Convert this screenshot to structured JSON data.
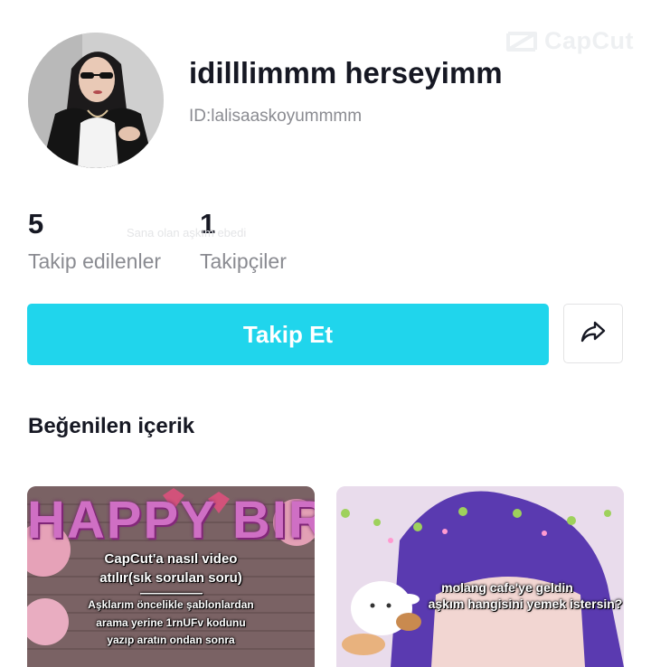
{
  "watermark": {
    "label": "CapCut",
    "icon": "capcut-logo-icon"
  },
  "profile": {
    "display_name": "idilllimmm herseyimm",
    "user_id": "ID:lalisaaskoyummmm",
    "avatar_icon": "profile-avatar"
  },
  "stats": {
    "following_count": "5",
    "following_label": "Takip edilenler",
    "followers_count": "1",
    "followers_label": "Takipçiler"
  },
  "overlay_caption": "Sana olan aşkım ebedi",
  "actions": {
    "follow_label": "Takip Et",
    "share_icon": "share-arrow-icon"
  },
  "liked_section": {
    "title": "Beğenilen içerik",
    "items": [
      {
        "background_text": "HAPPY BIRTHDAY",
        "lines": [
          "CapCut'a nasıl video",
          "atılır(sık sorulan soru)",
          "-----------------------",
          "Aşklarım öncelikle şablonlardan",
          "arama yerine 1rnUFv kodunu",
          "yazıp aratın ondan sonra"
        ]
      },
      {
        "lines": [
          "molang cafe'ye geldin",
          "aşkım hangisini yemek istersin?"
        ]
      }
    ]
  },
  "colors": {
    "accent": "#20d5ec",
    "text_primary": "#161823",
    "text_secondary": "#8a8b91",
    "border": "#e3e3e4"
  }
}
